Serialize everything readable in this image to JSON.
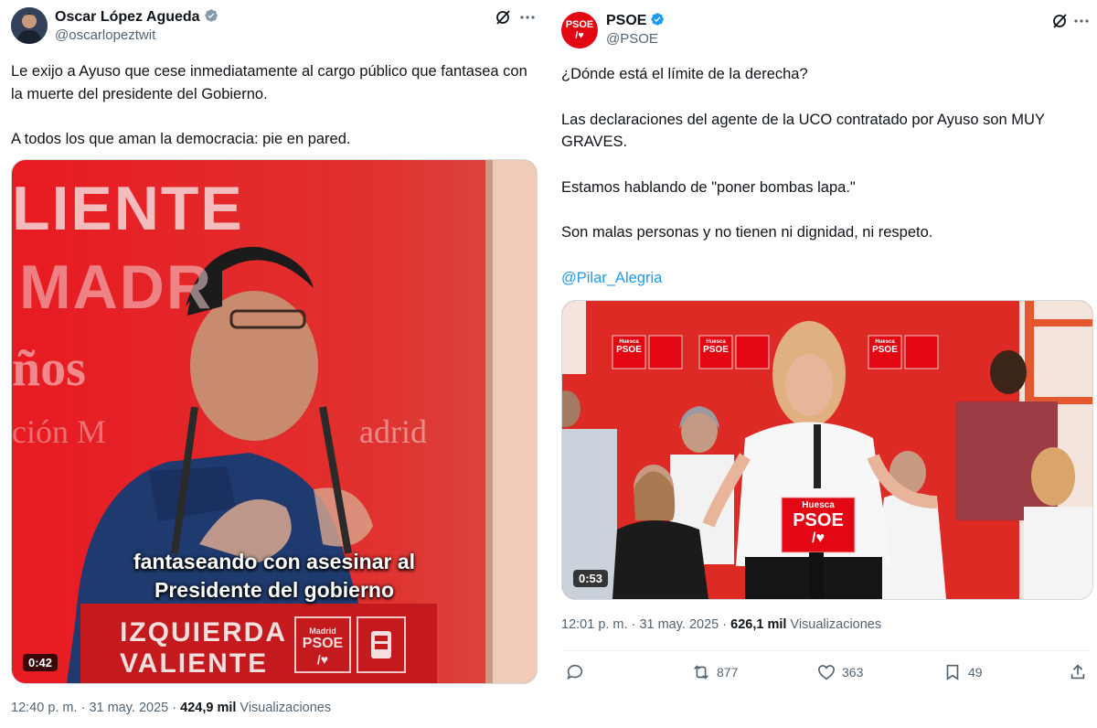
{
  "left_tweet": {
    "author_name": "Oscar López Agueda",
    "author_handle": "@oscarlopeztwit",
    "text_p1": "Le exijo a Ayuso que cese inmediatamente al cargo público que fantasea con la muerte del presidente del Gobierno.",
    "text_p2": "A todos los que aman la democracia: pie en pared.",
    "video": {
      "duration": "0:42",
      "bg_text_1": "LIENTE",
      "bg_text_2": "MADR",
      "bg_text_3": "ños",
      "bg_text_4": "ción M",
      "bg_text_5": "adrid",
      "caption_line_1": "fantaseando con asesinar al",
      "caption_line_2": "Presidente del gobierno",
      "podium_line_1": "IZQUIERDA",
      "podium_line_2": "VALIENTE",
      "podium_logo_top": "Madrid",
      "podium_logo_main": "PSOE"
    },
    "time": "12:40 p. m.",
    "date": "31 may. 2025",
    "views_count": "424,9 mil",
    "views_label": "Visualizaciones"
  },
  "right_tweet": {
    "author_name": "PSOE",
    "author_handle": "@PSOE",
    "avatar_text": "PSOE",
    "text_p1": "¿Dónde está el límite de la derecha?",
    "text_p2": "Las declaraciones del agente de la UCO contratado por Ayuso son MUY GRAVES.",
    "text_p3": "Estamos hablando de \"poner bombas lapa.\"",
    "text_p4": "Son malas personas y no tienen ni dignidad, ni respeto.",
    "mention": "@Pilar_Alegria",
    "video": {
      "duration": "0:53",
      "banner_top": "Huesca",
      "banner_main": "PSOE",
      "podium_top": "Huesca",
      "podium_main": "PSOE"
    },
    "time": "12:01 p. m.",
    "date": "31 may. 2025",
    "views_count": "626,1 mil",
    "views_label": "Visualizaciones",
    "actions": {
      "retweets": "877",
      "likes": "363",
      "bookmarks": "49"
    }
  },
  "colors": {
    "verified": "#1d9bf0",
    "psoe_red": "#e30613",
    "text_secondary": "#536471"
  }
}
